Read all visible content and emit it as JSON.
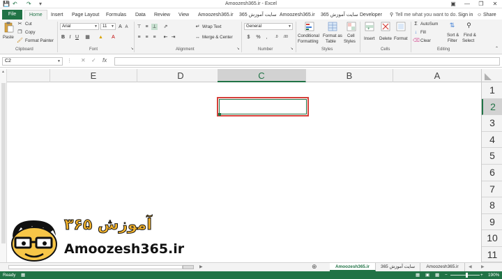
{
  "window": {
    "title": "Amoozesh365.ir - Excel",
    "signin": "Sign in",
    "share": "Share",
    "tellme": "Tell me what you want to do..."
  },
  "tabs": [
    {
      "label": "File"
    },
    {
      "label": "Home"
    },
    {
      "label": "Insert"
    },
    {
      "label": "Page Layout"
    },
    {
      "label": "Formulas"
    },
    {
      "label": "Data"
    },
    {
      "label": "Review"
    },
    {
      "label": "View"
    },
    {
      "label": "Amoozesh365.ir"
    },
    {
      "label": "سایت آموزش 365"
    },
    {
      "label": "Amoozesh365.ir"
    },
    {
      "label": "سایت آموزش 365"
    },
    {
      "label": "Developer"
    }
  ],
  "ribbon": {
    "clipboard": {
      "paste": "Paste",
      "cut": "Cut",
      "copy": "Copy",
      "format_painter": "Format Painter",
      "label": "Clipboard"
    },
    "font": {
      "name": "Arial",
      "size": "11",
      "label": "Font"
    },
    "alignment": {
      "wrap_text": "Wrap Text",
      "merge_center": "Merge & Center",
      "label": "Alignment"
    },
    "number": {
      "format": "General",
      "label": "Number"
    },
    "styles": {
      "conditional": "Conditional",
      "conditional2": "Formatting",
      "format_as": "Format as",
      "table": "Table",
      "cell": "Cell",
      "styles2": "Styles",
      "label": "Styles"
    },
    "cells": {
      "insert": "Insert",
      "delete": "Delete",
      "format": "Format",
      "label": "Cells"
    },
    "editing": {
      "autosum": "AutoSum",
      "fill": "Fill",
      "clear": "Clear",
      "sort": "Sort &",
      "filter": "Filter",
      "find": "Find &",
      "select": "Select",
      "label": "Editing"
    }
  },
  "formula_bar": {
    "name_box": "C2",
    "fx": "fx",
    "value": ""
  },
  "columns": [
    "E",
    "D",
    "C",
    "B",
    "A"
  ],
  "selected_column": "C",
  "rows": [
    "1",
    "2",
    "3",
    "4",
    "5",
    "6",
    "7",
    "8",
    "9",
    "10",
    "11"
  ],
  "selected_row": "2",
  "sheets": [
    {
      "label": "Amoozesh365.ir",
      "active": true
    },
    {
      "label": "سایت آموزش 365",
      "active": false
    },
    {
      "label": "Amoozesh365.ir",
      "active": false
    }
  ],
  "status": {
    "ready": "Ready",
    "zoom": "190%"
  },
  "logo": {
    "persian": "آموزش ۳۶۵",
    "url": "Amoozesh365.ir"
  },
  "colors": {
    "excel_green": "#217346",
    "highlight_red": "#d6403a"
  }
}
